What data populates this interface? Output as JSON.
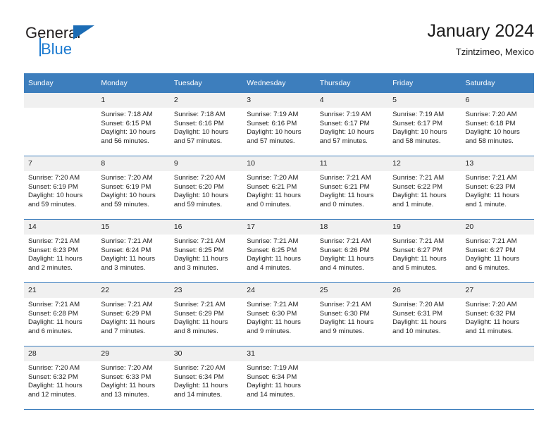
{
  "brand": {
    "name_top": "General",
    "name_bottom": "Blue",
    "accent_color": "#1b7ad0",
    "triangle_color": "#1b6cb5",
    "logo_icon": "triangle-flag-icon"
  },
  "header": {
    "title": "January 2024",
    "subtitle": "Tzintzimeo, Mexico"
  },
  "calendar": {
    "header_bg": "#3d7ebd",
    "header_text_color": "#ffffff",
    "daynum_bg": "#f0f0f0",
    "weekdays": [
      "Sunday",
      "Monday",
      "Tuesday",
      "Wednesday",
      "Thursday",
      "Friday",
      "Saturday"
    ],
    "weeks": [
      [
        {
          "day": "",
          "sunrise": "",
          "sunset": "",
          "daylight_line1": "",
          "daylight_line2": "",
          "empty": true
        },
        {
          "day": "1",
          "sunrise": "Sunrise: 7:18 AM",
          "sunset": "Sunset: 6:15 PM",
          "daylight_line1": "Daylight: 10 hours",
          "daylight_line2": "and 56 minutes."
        },
        {
          "day": "2",
          "sunrise": "Sunrise: 7:18 AM",
          "sunset": "Sunset: 6:16 PM",
          "daylight_line1": "Daylight: 10 hours",
          "daylight_line2": "and 57 minutes."
        },
        {
          "day": "3",
          "sunrise": "Sunrise: 7:19 AM",
          "sunset": "Sunset: 6:16 PM",
          "daylight_line1": "Daylight: 10 hours",
          "daylight_line2": "and 57 minutes."
        },
        {
          "day": "4",
          "sunrise": "Sunrise: 7:19 AM",
          "sunset": "Sunset: 6:17 PM",
          "daylight_line1": "Daylight: 10 hours",
          "daylight_line2": "and 57 minutes."
        },
        {
          "day": "5",
          "sunrise": "Sunrise: 7:19 AM",
          "sunset": "Sunset: 6:17 PM",
          "daylight_line1": "Daylight: 10 hours",
          "daylight_line2": "and 58 minutes."
        },
        {
          "day": "6",
          "sunrise": "Sunrise: 7:20 AM",
          "sunset": "Sunset: 6:18 PM",
          "daylight_line1": "Daylight: 10 hours",
          "daylight_line2": "and 58 minutes."
        }
      ],
      [
        {
          "day": "7",
          "sunrise": "Sunrise: 7:20 AM",
          "sunset": "Sunset: 6:19 PM",
          "daylight_line1": "Daylight: 10 hours",
          "daylight_line2": "and 59 minutes."
        },
        {
          "day": "8",
          "sunrise": "Sunrise: 7:20 AM",
          "sunset": "Sunset: 6:19 PM",
          "daylight_line1": "Daylight: 10 hours",
          "daylight_line2": "and 59 minutes."
        },
        {
          "day": "9",
          "sunrise": "Sunrise: 7:20 AM",
          "sunset": "Sunset: 6:20 PM",
          "daylight_line1": "Daylight: 10 hours",
          "daylight_line2": "and 59 minutes."
        },
        {
          "day": "10",
          "sunrise": "Sunrise: 7:20 AM",
          "sunset": "Sunset: 6:21 PM",
          "daylight_line1": "Daylight: 11 hours",
          "daylight_line2": "and 0 minutes."
        },
        {
          "day": "11",
          "sunrise": "Sunrise: 7:21 AM",
          "sunset": "Sunset: 6:21 PM",
          "daylight_line1": "Daylight: 11 hours",
          "daylight_line2": "and 0 minutes."
        },
        {
          "day": "12",
          "sunrise": "Sunrise: 7:21 AM",
          "sunset": "Sunset: 6:22 PM",
          "daylight_line1": "Daylight: 11 hours",
          "daylight_line2": "and 1 minute."
        },
        {
          "day": "13",
          "sunrise": "Sunrise: 7:21 AM",
          "sunset": "Sunset: 6:23 PM",
          "daylight_line1": "Daylight: 11 hours",
          "daylight_line2": "and 1 minute."
        }
      ],
      [
        {
          "day": "14",
          "sunrise": "Sunrise: 7:21 AM",
          "sunset": "Sunset: 6:23 PM",
          "daylight_line1": "Daylight: 11 hours",
          "daylight_line2": "and 2 minutes."
        },
        {
          "day": "15",
          "sunrise": "Sunrise: 7:21 AM",
          "sunset": "Sunset: 6:24 PM",
          "daylight_line1": "Daylight: 11 hours",
          "daylight_line2": "and 3 minutes."
        },
        {
          "day": "16",
          "sunrise": "Sunrise: 7:21 AM",
          "sunset": "Sunset: 6:25 PM",
          "daylight_line1": "Daylight: 11 hours",
          "daylight_line2": "and 3 minutes."
        },
        {
          "day": "17",
          "sunrise": "Sunrise: 7:21 AM",
          "sunset": "Sunset: 6:25 PM",
          "daylight_line1": "Daylight: 11 hours",
          "daylight_line2": "and 4 minutes."
        },
        {
          "day": "18",
          "sunrise": "Sunrise: 7:21 AM",
          "sunset": "Sunset: 6:26 PM",
          "daylight_line1": "Daylight: 11 hours",
          "daylight_line2": "and 4 minutes."
        },
        {
          "day": "19",
          "sunrise": "Sunrise: 7:21 AM",
          "sunset": "Sunset: 6:27 PM",
          "daylight_line1": "Daylight: 11 hours",
          "daylight_line2": "and 5 minutes."
        },
        {
          "day": "20",
          "sunrise": "Sunrise: 7:21 AM",
          "sunset": "Sunset: 6:27 PM",
          "daylight_line1": "Daylight: 11 hours",
          "daylight_line2": "and 6 minutes."
        }
      ],
      [
        {
          "day": "21",
          "sunrise": "Sunrise: 7:21 AM",
          "sunset": "Sunset: 6:28 PM",
          "daylight_line1": "Daylight: 11 hours",
          "daylight_line2": "and 6 minutes."
        },
        {
          "day": "22",
          "sunrise": "Sunrise: 7:21 AM",
          "sunset": "Sunset: 6:29 PM",
          "daylight_line1": "Daylight: 11 hours",
          "daylight_line2": "and 7 minutes."
        },
        {
          "day": "23",
          "sunrise": "Sunrise: 7:21 AM",
          "sunset": "Sunset: 6:29 PM",
          "daylight_line1": "Daylight: 11 hours",
          "daylight_line2": "and 8 minutes."
        },
        {
          "day": "24",
          "sunrise": "Sunrise: 7:21 AM",
          "sunset": "Sunset: 6:30 PM",
          "daylight_line1": "Daylight: 11 hours",
          "daylight_line2": "and 9 minutes."
        },
        {
          "day": "25",
          "sunrise": "Sunrise: 7:21 AM",
          "sunset": "Sunset: 6:30 PM",
          "daylight_line1": "Daylight: 11 hours",
          "daylight_line2": "and 9 minutes."
        },
        {
          "day": "26",
          "sunrise": "Sunrise: 7:20 AM",
          "sunset": "Sunset: 6:31 PM",
          "daylight_line1": "Daylight: 11 hours",
          "daylight_line2": "and 10 minutes."
        },
        {
          "day": "27",
          "sunrise": "Sunrise: 7:20 AM",
          "sunset": "Sunset: 6:32 PM",
          "daylight_line1": "Daylight: 11 hours",
          "daylight_line2": "and 11 minutes."
        }
      ],
      [
        {
          "day": "28",
          "sunrise": "Sunrise: 7:20 AM",
          "sunset": "Sunset: 6:32 PM",
          "daylight_line1": "Daylight: 11 hours",
          "daylight_line2": "and 12 minutes."
        },
        {
          "day": "29",
          "sunrise": "Sunrise: 7:20 AM",
          "sunset": "Sunset: 6:33 PM",
          "daylight_line1": "Daylight: 11 hours",
          "daylight_line2": "and 13 minutes."
        },
        {
          "day": "30",
          "sunrise": "Sunrise: 7:20 AM",
          "sunset": "Sunset: 6:34 PM",
          "daylight_line1": "Daylight: 11 hours",
          "daylight_line2": "and 14 minutes."
        },
        {
          "day": "31",
          "sunrise": "Sunrise: 7:19 AM",
          "sunset": "Sunset: 6:34 PM",
          "daylight_line1": "Daylight: 11 hours",
          "daylight_line2": "and 14 minutes."
        },
        {
          "day": "",
          "sunrise": "",
          "sunset": "",
          "daylight_line1": "",
          "daylight_line2": "",
          "empty": true
        },
        {
          "day": "",
          "sunrise": "",
          "sunset": "",
          "daylight_line1": "",
          "daylight_line2": "",
          "empty": true
        },
        {
          "day": "",
          "sunrise": "",
          "sunset": "",
          "daylight_line1": "",
          "daylight_line2": "",
          "empty": true
        }
      ]
    ]
  }
}
